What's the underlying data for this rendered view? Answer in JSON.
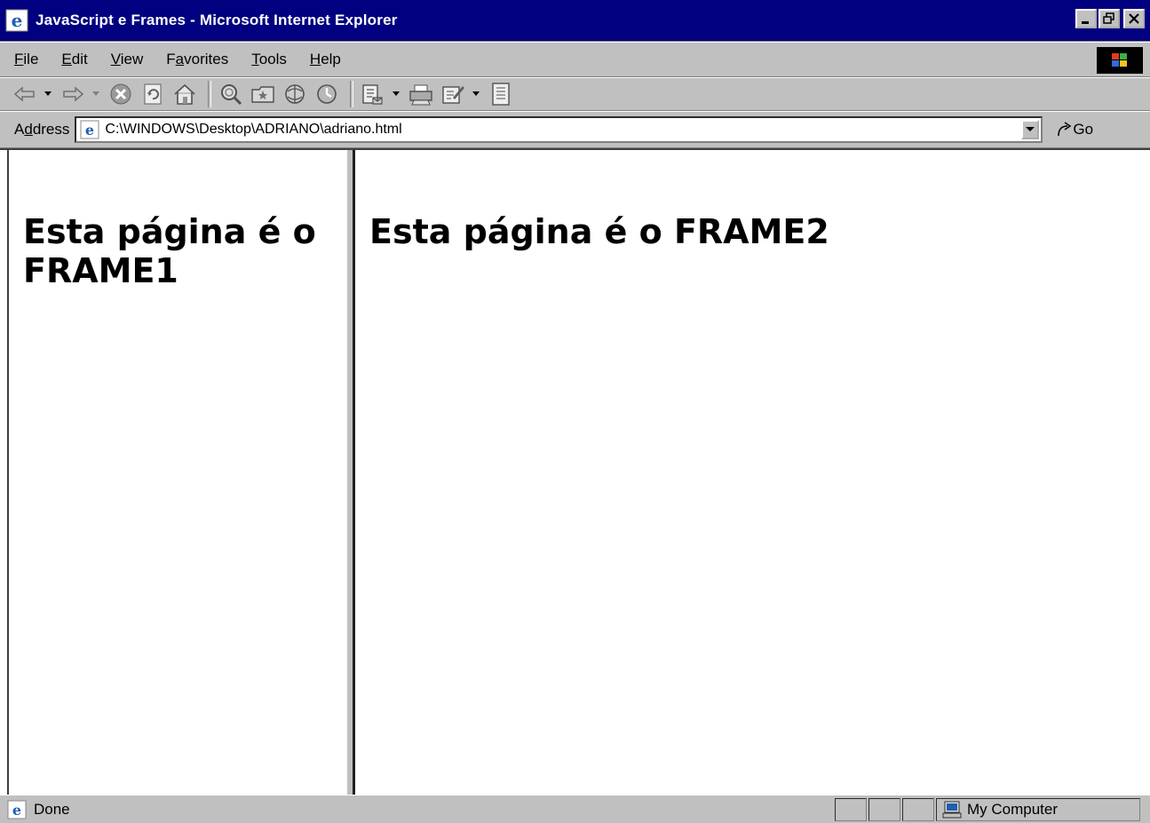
{
  "window": {
    "title": "JavaScript e Frames - Microsoft Internet Explorer",
    "controls": [
      "minimize-icon",
      "maximize-icon",
      "close-icon"
    ]
  },
  "menubar": {
    "items": [
      {
        "label": "File",
        "mnemonic": "F",
        "rest": "ile"
      },
      {
        "label": "Edit",
        "mnemonic": "E",
        "rest": "dit"
      },
      {
        "label": "View",
        "mnemonic": "V",
        "rest": "iew"
      },
      {
        "label": "Favorites",
        "pre": "F",
        "mnemonic": "a",
        "rest": "vorites"
      },
      {
        "label": "Tools",
        "mnemonic": "T",
        "rest": "ools"
      },
      {
        "label": "Help",
        "mnemonic": "H",
        "rest": "elp"
      }
    ]
  },
  "toolbar": {
    "buttons": [
      "back-icon",
      "forward-icon",
      "stop-icon",
      "refresh-icon",
      "home-icon",
      "search-icon",
      "favorites-icon",
      "media-icon",
      "history-icon",
      "mail-icon",
      "print-icon",
      "edit-icon",
      "discuss-icon"
    ]
  },
  "address": {
    "label_pre": "A",
    "label_mnemonic": "d",
    "label_rest": "dress",
    "url": "C:\\WINDOWS\\Desktop\\ADRIANO\\adriano.html",
    "go_label": "Go"
  },
  "frames": {
    "frame1_heading": "Esta página é o FRAME1",
    "frame2_heading": "Esta página é o FRAME2"
  },
  "status": {
    "text": "Done",
    "zone": "My Computer"
  },
  "colors": {
    "titlebar": "#000080",
    "chrome": "#c0c0c0"
  }
}
